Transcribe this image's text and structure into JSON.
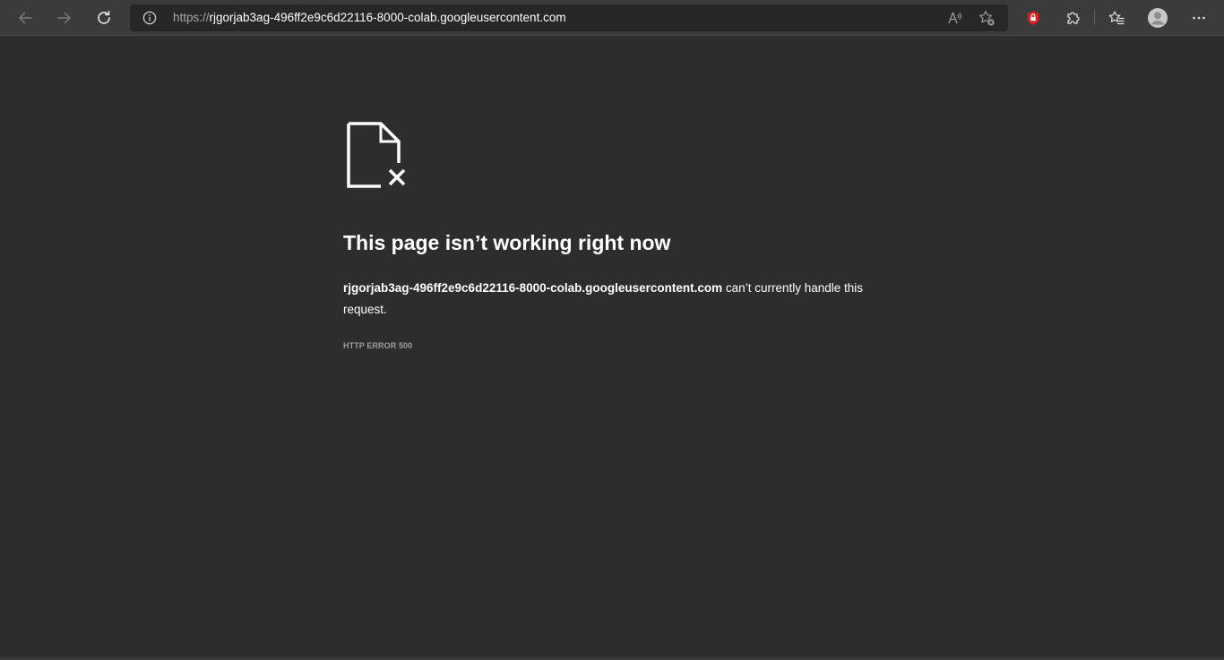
{
  "browser": {
    "url_scheme": "https://",
    "url_host": "rjgorjab3ag-496ff2e9c6d22116-8000-colab.googleusercontent.com",
    "icons": {
      "back": "arrow-left-icon",
      "forward": "arrow-right-icon",
      "refresh": "refresh-icon",
      "site_info": "info-icon",
      "read_aloud": "read-aloud-icon",
      "add_favorite": "star-add-icon",
      "extension_shield": "shield-lock-icon",
      "extensions": "puzzle-icon",
      "favorites": "favorites-icon",
      "profile": "avatar-icon",
      "menu": "more-icon"
    }
  },
  "error_page": {
    "headline": "This page isn’t working right now",
    "host": "rjgorjab3ag-496ff2e9c6d22116-8000-colab.googleusercontent.com",
    "message_rest": " can’t currently handle this request.",
    "error_code": "HTTP ERROR 500",
    "icon": "broken-file-icon"
  },
  "colors": {
    "page_background": "#2d2d2d",
    "toolbar_background": "#3b3b3b",
    "address_background": "#272727",
    "shield_red": "#d6201f",
    "error_code_gray": "#9e9e9e"
  }
}
